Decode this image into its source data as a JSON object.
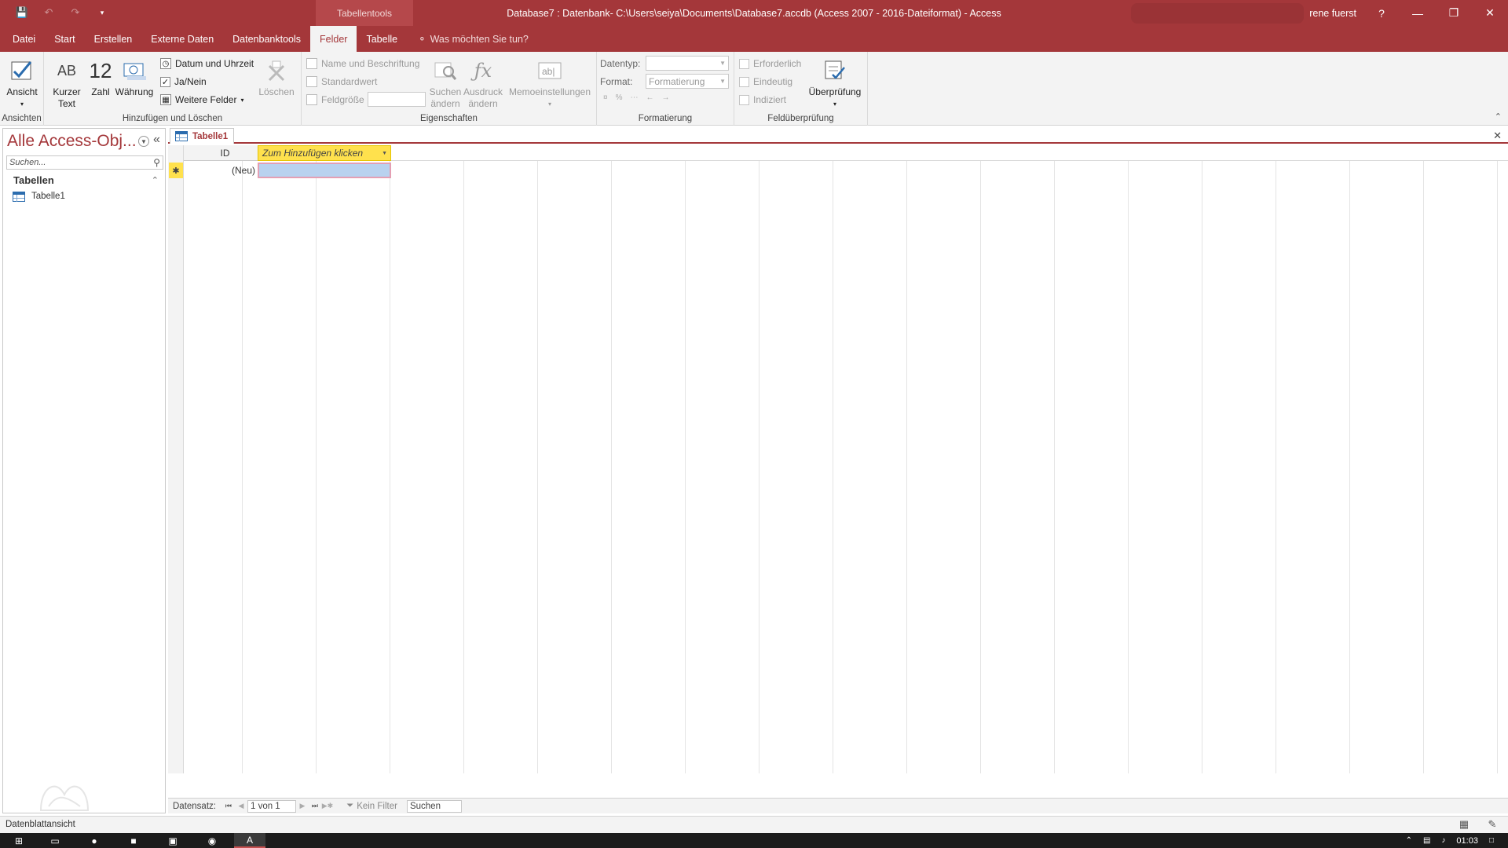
{
  "titlebar": {
    "contextual_tab": "Tabellentools",
    "title": "Database7 : Datenbank- C:\\Users\\seiya\\Documents\\Database7.accdb (Access 2007 - 2016-Dateiformat)  -  Access",
    "user": "rene fuerst",
    "help": "?"
  },
  "tabs": [
    "Datei",
    "Start",
    "Erstellen",
    "Externe Daten",
    "Datenbanktools",
    "Felder",
    "Tabelle"
  ],
  "active_tab": "Felder",
  "tell_me": "Was möchten Sie tun?",
  "ribbon": {
    "ansichten": {
      "label": "Ansichten",
      "view_button": "Ansicht"
    },
    "hinzufuegen": {
      "label": "Hinzufügen und Löschen",
      "kurzer_text_l1": "Kurzer",
      "kurzer_text_l2": "Text",
      "zahl": "Zahl",
      "zahl_glyph": "12",
      "waehrung": "Währung",
      "datum": "Datum und Uhrzeit",
      "janein": "Ja/Nein",
      "weitere": "Weitere Felder",
      "loeschen": "Löschen"
    },
    "eigenschaften": {
      "label": "Eigenschaften",
      "name": "Name und Beschriftung",
      "standardwert": "Standardwert",
      "feldgroesse": "Feldgröße",
      "suchen_l1": "Suchen",
      "suchen_l2": "ändern",
      "ausdruck_l1": "Ausdruck",
      "ausdruck_l2": "ändern",
      "memo": "Memoeinstellungen"
    },
    "formatierung": {
      "label": "Formatierung",
      "datentyp_label": "Datentyp:",
      "format_label": "Format:",
      "format_value": "Formatierung"
    },
    "feldueberpruefung": {
      "label": "Feldüberprüfung",
      "erforderlich": "Erforderlich",
      "eindeutig": "Eindeutig",
      "indiziert": "Indiziert",
      "ueberpruefung": "Überprüfung"
    }
  },
  "nav": {
    "title": "Alle Access-Obj...",
    "search_placeholder": "Suchen...",
    "group": "Tabellen",
    "items": [
      "Tabelle1"
    ]
  },
  "document": {
    "tab": "Tabelle1",
    "columns": [
      "ID",
      "Zum Hinzufügen klicken"
    ],
    "new_row_marker": "✱",
    "new_row_id": "(Neu)"
  },
  "record_nav": {
    "label": "Datensatz:",
    "position": "1 von 1",
    "filter": "Kein Filter",
    "search": "Suchen"
  },
  "statusbar": {
    "text": "Datenblattansicht"
  },
  "taskbar": {
    "clock": "01:03"
  },
  "colors": {
    "accent": "#a4373a",
    "header_highlight": "#ffe14d",
    "selected_cell": "#b9d2ef"
  }
}
